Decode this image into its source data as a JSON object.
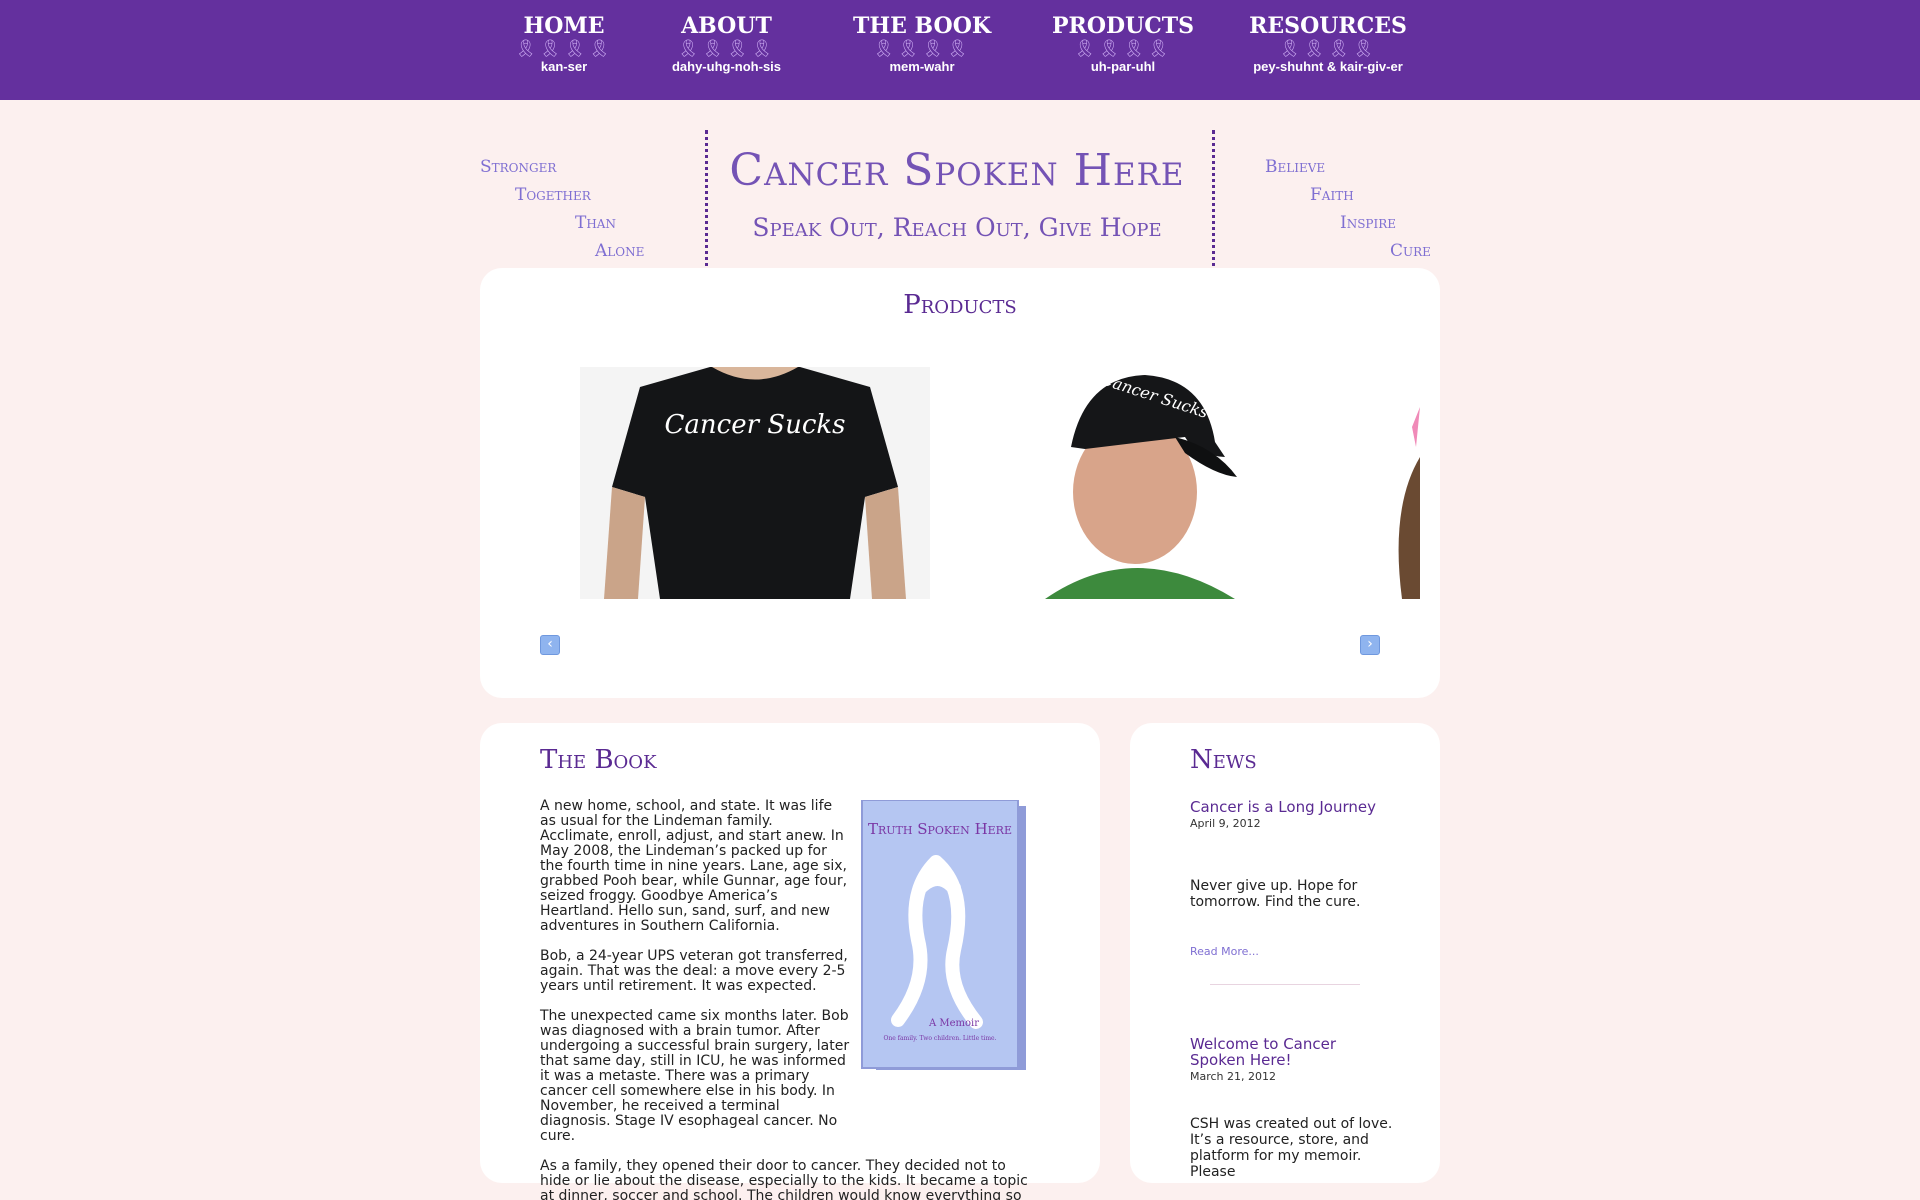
{
  "nav": [
    {
      "title": "HOME",
      "ribbons": "🎗🎗🎗🎗",
      "sub": "kan-ser"
    },
    {
      "title": "ABOUT",
      "ribbons": "🎗🎗🎗🎗",
      "sub": "dahy-uhg-noh-sis"
    },
    {
      "title": "THE BOOK",
      "ribbons": "🎗🎗🎗🎗",
      "sub": "mem-wahr"
    },
    {
      "title": "PRODUCTS",
      "ribbons": "🎗🎗🎗🎗",
      "sub": "uh-par-uhl"
    },
    {
      "title": "RESOURCES",
      "ribbons": "🎗🎗🎗🎗",
      "sub": "pey-shuhnt & kair-giv-er"
    }
  ],
  "header": {
    "title": "Cancer Spoken Here",
    "subtitle": "Speak Out, Reach Out, Give Hope",
    "left_tagline": [
      "Stronger",
      "Together",
      "Than",
      "Alone"
    ],
    "right_tagline": [
      "Believe",
      "Faith",
      "Inspire",
      "Cure"
    ]
  },
  "products": {
    "heading": "Products",
    "slides": [
      {
        "alt": "Cancer Sucks t-shirt",
        "text": "Cancer Sucks"
      },
      {
        "alt": "Cancer Sucks cap",
        "text": "Cancer Sucks"
      },
      {
        "alt": "Pink product"
      }
    ],
    "prev_icon": "‹",
    "next_icon": "›"
  },
  "book": {
    "heading": "The Book",
    "cover_title": "Truth Spoken Here",
    "cover_caption1": "A Memoir",
    "cover_caption2": "One family. Two children. Little time.",
    "paragraphs": [
      "A new home, school, and state. It was life as usual for the Lindeman family. Acclimate, enroll, adjust, and start anew. In May 2008, the Lindeman’s packed up for the fourth time in nine years. Lane, age six, grabbed Pooh bear, while Gunnar, age four, seized froggy. Goodbye America’s Heartland. Hello sun, sand, surf, and new adventures in Southern California.",
      "Bob, a 24-year UPS veteran got transferred, again. That was the deal: a move every 2-5 years until retirement. It was expected.",
      "The unexpected came six months later. Bob was diagnosed with a brain tumor. After undergoing a successful brain surgery, later that same day, still in ICU, he was informed it was a metaste. There was a primary cancer cell somewhere else in his body. In November, he received a terminal diagnosis. Stage IV esophageal cancer. No cure.",
      "As a family, they opened their door to cancer. They decided not to hide or lie about the disease, especially to the kids. It became a topic at dinner, soccer and school. The children would know everything so"
    ]
  },
  "news": {
    "heading": "News",
    "items": [
      {
        "title": "Cancer is a Long Journey",
        "date": "April 9, 2012",
        "body": "Never give up. Hope for tomorrow. Find the cure.",
        "more": "Read More..."
      },
      {
        "title": "Welcome to Cancer Spoken Here!",
        "date": "March 21, 2012",
        "body": "CSH was created out of love. It’s a resource, store, and platform for my memoir. Please"
      }
    ]
  },
  "colors": {
    "nav_bg": "#64309e",
    "accent": "#5a2a92",
    "tagline": "#7f6fd2",
    "page_bg": "#fcf0ef"
  }
}
